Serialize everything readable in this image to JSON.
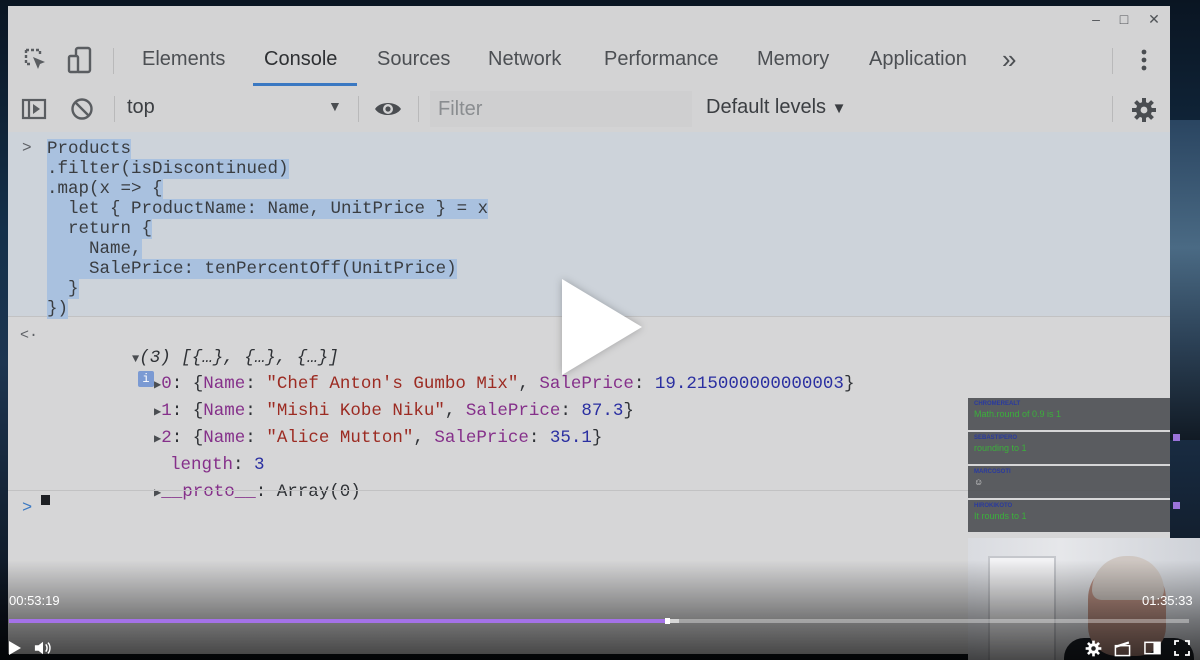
{
  "window_controls": [
    "–",
    "□",
    "✕"
  ],
  "tabs": [
    "Elements",
    "Console",
    "Sources",
    "Network",
    "Performance",
    "Memory",
    "Application"
  ],
  "tab_overflow": "»",
  "toolbar": {
    "context": "top",
    "filter_placeholder": "Filter",
    "levels": "Default levels"
  },
  "console_input": {
    "lines": [
      "Products",
      ".filter(isDiscontinued)",
      ".map(x => {",
      "  let { ProductName: Name, UnitPrice } = x",
      "  return {",
      "    Name,",
      "    SalePrice: tenPercentOff(UnitPrice)",
      "  }",
      "})"
    ]
  },
  "console_output": {
    "summary": "(3) [{…}, {…}, {…}]",
    "info_badge": "i",
    "items": [
      {
        "index": "0",
        "name": "\"Chef Anton's Gumbo Mix\"",
        "saleprice": "19.215000000000003"
      },
      {
        "index": "1",
        "name": "\"Mishi Kobe Niku\"",
        "saleprice": "87.3"
      },
      {
        "index": "2",
        "name": "\"Alice Mutton\"",
        "saleprice": "35.1"
      }
    ],
    "length_key": "length",
    "length_value": "3",
    "proto_key": "__proto__",
    "proto_value": "Array(0)"
  },
  "chat": [
    {
      "user": "CHROMEREALT",
      "text": "Math.round of 0.9 is 1"
    },
    {
      "user": "SEBASTIPERO",
      "text": "rounding to 1"
    },
    {
      "user": "MARCOSOTI",
      "text": "☺"
    },
    {
      "user": "HIROKIKOTO",
      "text": "It rounds to 1"
    }
  ],
  "video": {
    "current_time": "00:53:19",
    "duration": "01:35:33",
    "progress_fraction": 0.558,
    "accent_color": "#a472e8"
  }
}
